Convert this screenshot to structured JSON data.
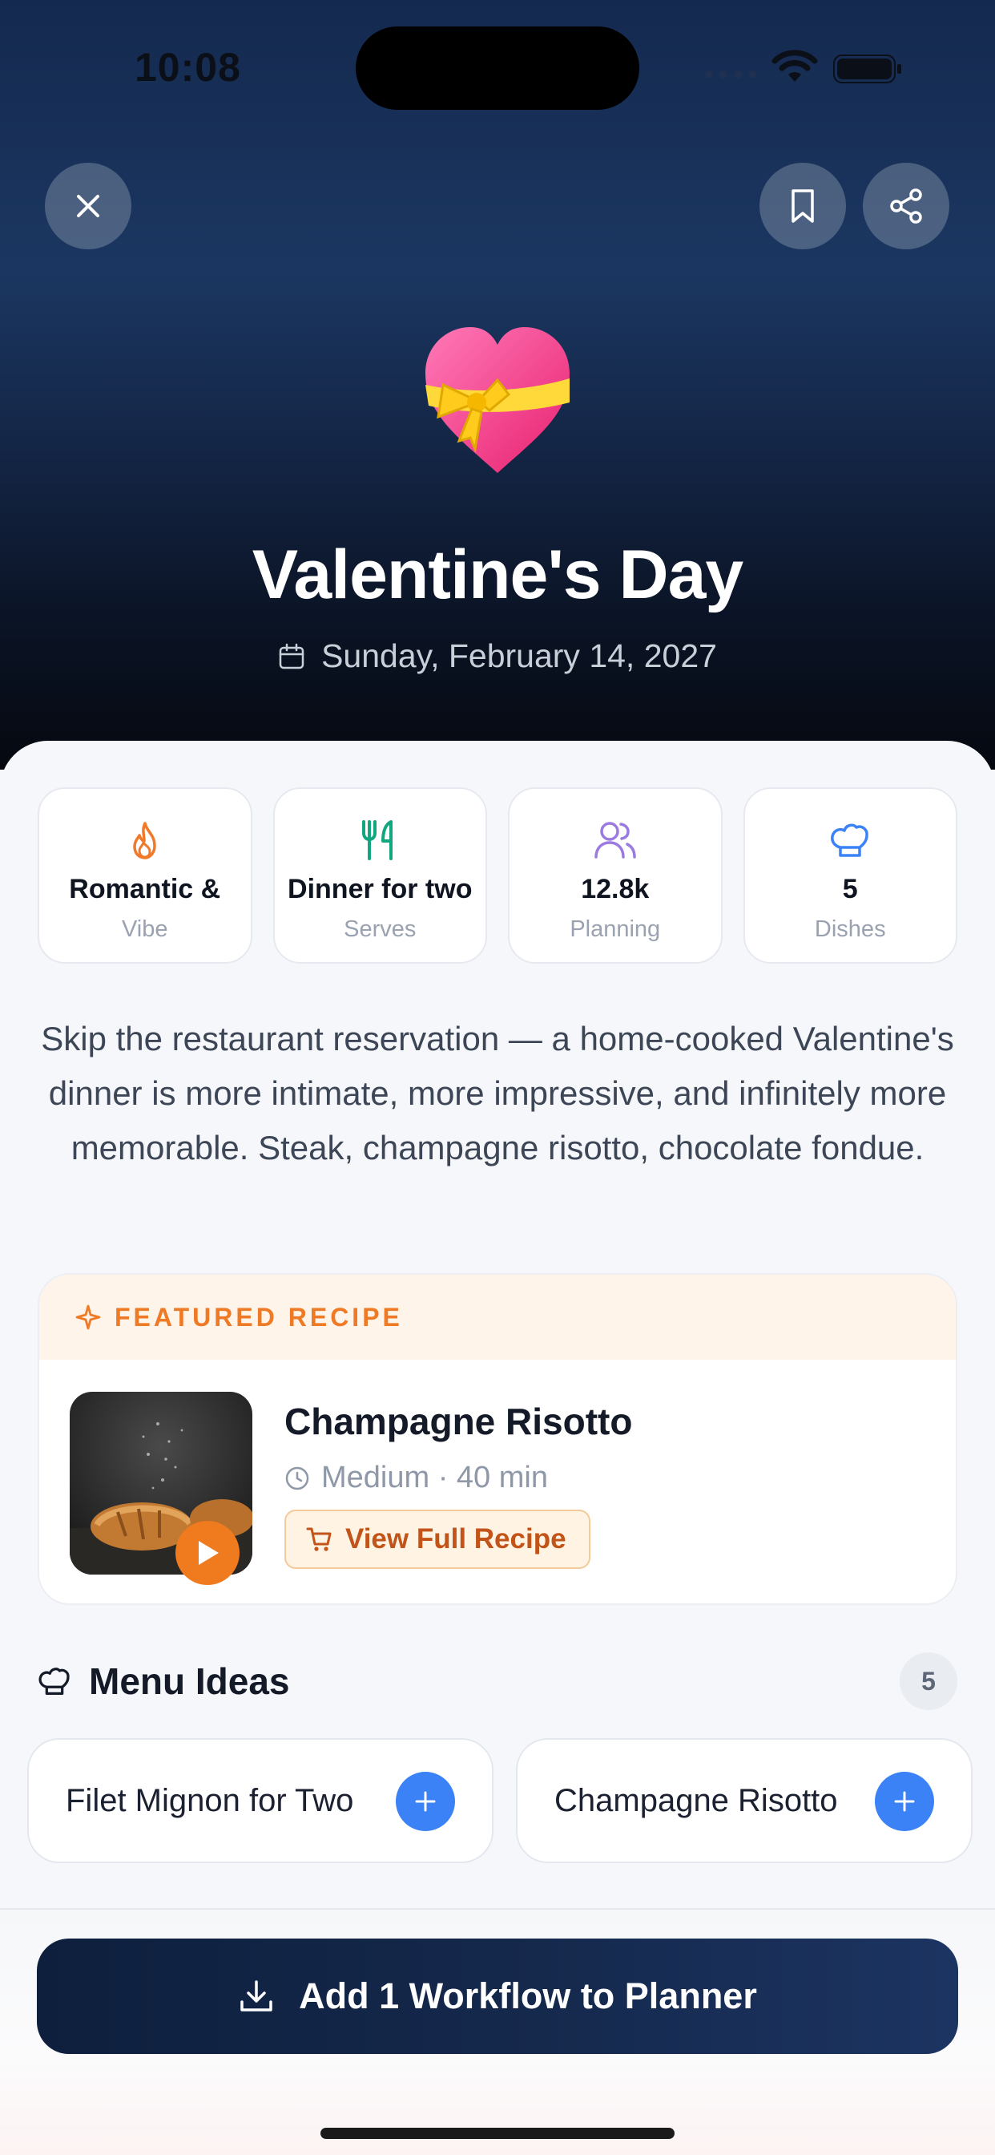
{
  "status_bar": {
    "time": "10:08"
  },
  "header": {
    "close_icon": "close-icon",
    "bookmark_icon": "bookmark-icon",
    "share_icon": "share-icon",
    "hero_emoji": "heart-with-ribbon",
    "title": "Valentine's Day",
    "date": "Sunday, February 14, 2027"
  },
  "stats": [
    {
      "icon": "flame-icon",
      "value": "Romantic &",
      "label": "Vibe",
      "color": "#f07a2a"
    },
    {
      "icon": "utensils-icon",
      "value": "Dinner for two",
      "label": "Serves",
      "color": "#12a77e"
    },
    {
      "icon": "users-icon",
      "value": "12.8k",
      "label": "Planning",
      "color": "#9b7be0"
    },
    {
      "icon": "chef-hat-icon",
      "value": "5",
      "label": "Dishes",
      "color": "#3b82f6"
    }
  ],
  "description": "Skip the restaurant reservation — a home-cooked Valentine's dinner is more intimate, more impressive, and infinitely more memorable. Steak, champagne risotto, chocolate fondue.",
  "featured": {
    "tag": "FEATURED RECIPE",
    "title": "Champagne Risotto",
    "meta": "Medium · 40 min",
    "button_label": "View Full Recipe"
  },
  "menu": {
    "title": "Menu Ideas",
    "count": "5",
    "items": [
      {
        "label": "Filet Mignon for Two"
      },
      {
        "label": "Champagne Risotto"
      }
    ]
  },
  "cta": {
    "label": "Add 1 Workflow to Planner"
  },
  "colors": {
    "accent_blue": "#3b82f6",
    "accent_orange": "#ee7a25",
    "cta_navy": "#12254a"
  }
}
